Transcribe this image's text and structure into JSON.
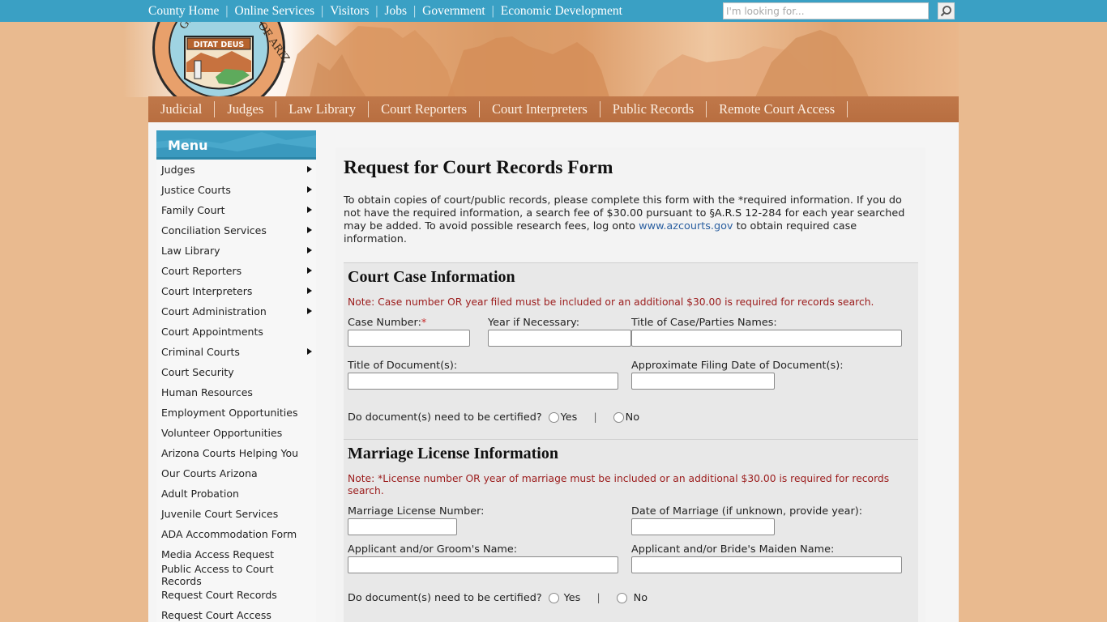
{
  "top_nav": {
    "items": [
      "County Home",
      "Online Services",
      "Visitors",
      "Jobs",
      "Government",
      "Economic Development"
    ],
    "separator": "|"
  },
  "search": {
    "placeholder": "I'm looking for...",
    "value": "",
    "icon": "search-icon"
  },
  "banner": {
    "seal_motto": "DITAT DEUS",
    "seal_text": "GREAT SEAL OF THE STATE OF ARIZONA"
  },
  "main_nav": {
    "items": [
      "Judicial",
      "Judges",
      "Law Library",
      "Court Reporters",
      "Court Interpreters",
      "Public Records",
      "Remote Court Access"
    ]
  },
  "sidebar": {
    "title": "Menu",
    "items": [
      {
        "label": "Judges",
        "has_submenu": true
      },
      {
        "label": "Justice Courts",
        "has_submenu": true
      },
      {
        "label": "Family Court",
        "has_submenu": true
      },
      {
        "label": "Conciliation Services",
        "has_submenu": true
      },
      {
        "label": "Law Library",
        "has_submenu": true
      },
      {
        "label": "Court Reporters",
        "has_submenu": true
      },
      {
        "label": "Court Interpreters",
        "has_submenu": true
      },
      {
        "label": "Court Administration",
        "has_submenu": true
      },
      {
        "label": "Court Appointments",
        "has_submenu": false
      },
      {
        "label": "Criminal Courts",
        "has_submenu": true
      },
      {
        "label": "Court Security",
        "has_submenu": false
      },
      {
        "label": "Human Resources",
        "has_submenu": false
      },
      {
        "label": "Employment Opportunities",
        "has_submenu": false
      },
      {
        "label": "Volunteer Opportunities",
        "has_submenu": false
      },
      {
        "label": "Arizona Courts Helping You",
        "has_submenu": false
      },
      {
        "label": "Our Courts Arizona",
        "has_submenu": false
      },
      {
        "label": "Adult Probation",
        "has_submenu": false
      },
      {
        "label": "Juvenile Court Services",
        "has_submenu": false
      },
      {
        "label": "ADA Accommodation Form",
        "has_submenu": false
      },
      {
        "label": "Media Access Request",
        "has_submenu": false
      },
      {
        "label": "Public Access to Court Records",
        "has_submenu": false
      },
      {
        "label": "Request Court Records",
        "has_submenu": false
      },
      {
        "label": "Request Court Access",
        "has_submenu": false
      }
    ]
  },
  "content": {
    "title": "Request for Court Records Form",
    "intro_before_link": "To obtain copies of court/public records, please complete this form with the *required information. If you do not have the required information, a search fee of $30.00 pursuant to §A.R.S 12-284 for each year searched may be added. To avoid possible research fees, log onto ",
    "intro_link": "www.azcourts.gov",
    "intro_after_link": " to obtain required case information.",
    "court_case": {
      "title": "Court Case Information",
      "note": "Note: Case number OR year filed must be included or an additional $30.00 is required for records search.",
      "case_number_label": "Case Number:",
      "required_mark": "*",
      "year_label": "Year if Necessary:",
      "title_of_case_label": "Title of Case/Parties Names:",
      "title_of_document_label": "Title of Document(s):",
      "filing_date_label": "Approximate Filing Date of Document(s):",
      "certified_question": "Do document(s) need to be certified?",
      "yes_label": "Yes",
      "no_label": "No",
      "radio_separator": "|",
      "values": {
        "case_number": "",
        "year": "",
        "title_of_case": "",
        "title_of_document": "",
        "filing_date": ""
      }
    },
    "marriage": {
      "title": "Marriage License Information",
      "note": "Note: *License number OR year of marriage must be included or an additional $30.00 is required for records search.",
      "license_number_label": "Marriage License Number:",
      "date_label": "Date of Marriage (if unknown, provide year):",
      "groom_label": "Applicant and/or Groom's Name:",
      "bride_label": "Applicant and/or Bride's Maiden Name:",
      "certified_question": "Do document(s) need to be certified?",
      "yes_label": "Yes",
      "no_label": "No",
      "radio_separator": "|",
      "values": {
        "license_number": "",
        "date": "",
        "groom": "",
        "bride": ""
      }
    }
  },
  "colors": {
    "top_bar": "#3aa0c4",
    "main_nav": "#b86e40",
    "page_bg": "#e9ba8f",
    "note_text": "#9b1b1b",
    "link": "#2a5fa0"
  }
}
